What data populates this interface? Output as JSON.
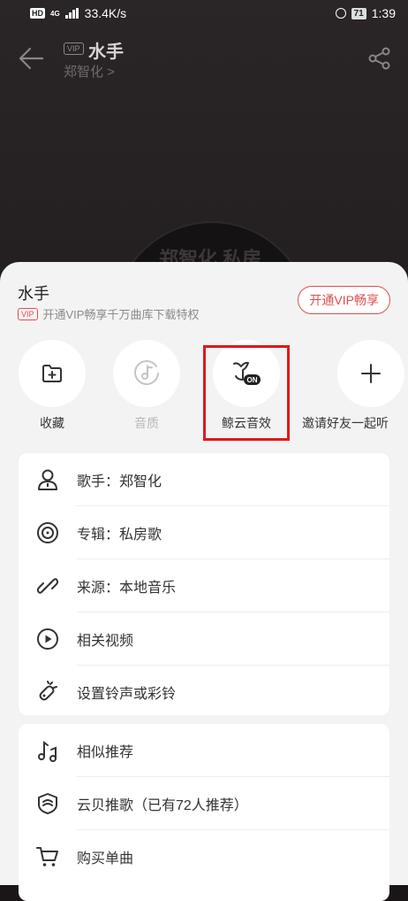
{
  "status_bar": {
    "network_badge": "HD",
    "signal_label": "4G",
    "speed": "33.4K/s",
    "battery": "71",
    "time": "1:39"
  },
  "player": {
    "vip_badge": "VIP",
    "song_title": "水手",
    "artist": "郑智化 >",
    "disc_text": "郑智化 私房"
  },
  "sheet": {
    "title": "水手",
    "vip_badge": "VIP",
    "vip_promo": "开通VIP畅享千万曲库下载特权",
    "vip_button": "开通VIP畅享",
    "actions": [
      {
        "label": "收藏",
        "icon": "folder-add-icon"
      },
      {
        "label": "音质",
        "icon": "quality-disc-icon",
        "disabled": true
      },
      {
        "label": "鲸云音效",
        "icon": "whale-sound-effect-icon",
        "badge": "ON"
      },
      {
        "label": "邀请好友一起听",
        "icon": "plus-icon"
      }
    ],
    "menu_group1": [
      {
        "label": "歌手：郑智化",
        "icon": "singer-icon"
      },
      {
        "label": "专辑：私房歌",
        "icon": "album-icon"
      },
      {
        "label": "来源：本地音乐",
        "icon": "link-icon"
      },
      {
        "label": "相关视频",
        "icon": "video-icon"
      },
      {
        "label": "设置铃声或彩铃",
        "icon": "ringtone-icon"
      }
    ],
    "menu_group2": [
      {
        "label": "相似推荐",
        "icon": "similar-icon"
      },
      {
        "label": "云贝推歌（已有72人推荐）",
        "icon": "cloud-coin-icon"
      },
      {
        "label": "购买单曲",
        "icon": "cart-icon"
      }
    ]
  },
  "colors": {
    "accent_red": "#e24c4c",
    "highlight_box": "#e11818",
    "sheet_bg": "#f3f3f3"
  }
}
